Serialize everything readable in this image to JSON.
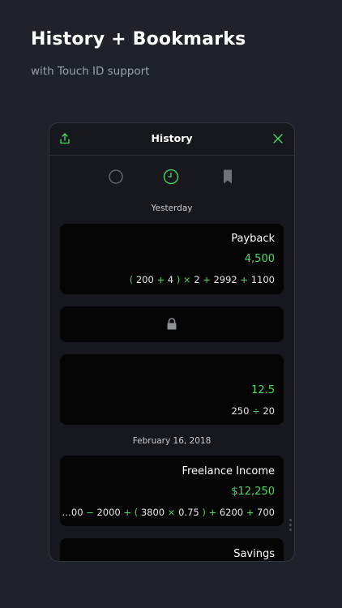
{
  "promo": {
    "headline": "History + Bookmarks",
    "subline": "with Touch ID support"
  },
  "header": {
    "title": "History"
  },
  "tabs": [
    {
      "icon": "circle-icon"
    },
    {
      "icon": "clock-icon",
      "active": true
    },
    {
      "icon": "bookmark-icon"
    }
  ],
  "sections": {
    "yesterday": "Yesterday",
    "feb16": "February 16, 2018"
  },
  "cards": [
    {
      "name": "Payback",
      "result": "4,500",
      "expr": [
        "(",
        "200",
        "+",
        "4",
        ")",
        "×",
        "2",
        "+",
        "2992",
        "+",
        "1100"
      ]
    },
    {
      "locked": true
    },
    {
      "name": "",
      "result": "12.5",
      "expr": [
        "250",
        "÷",
        "20"
      ]
    },
    {
      "name": "Freelance Income",
      "result": "$12,250",
      "expr": [
        "…00",
        "−",
        "2000",
        "+",
        "(",
        "3800",
        "×",
        "0.75",
        ")",
        "+",
        "6200",
        "+",
        "700"
      ]
    },
    {
      "name": "Savings"
    }
  ],
  "colors": {
    "background": "#1f222b",
    "accent": "#4cd964",
    "card": "#050506",
    "panel": "#16181d"
  }
}
